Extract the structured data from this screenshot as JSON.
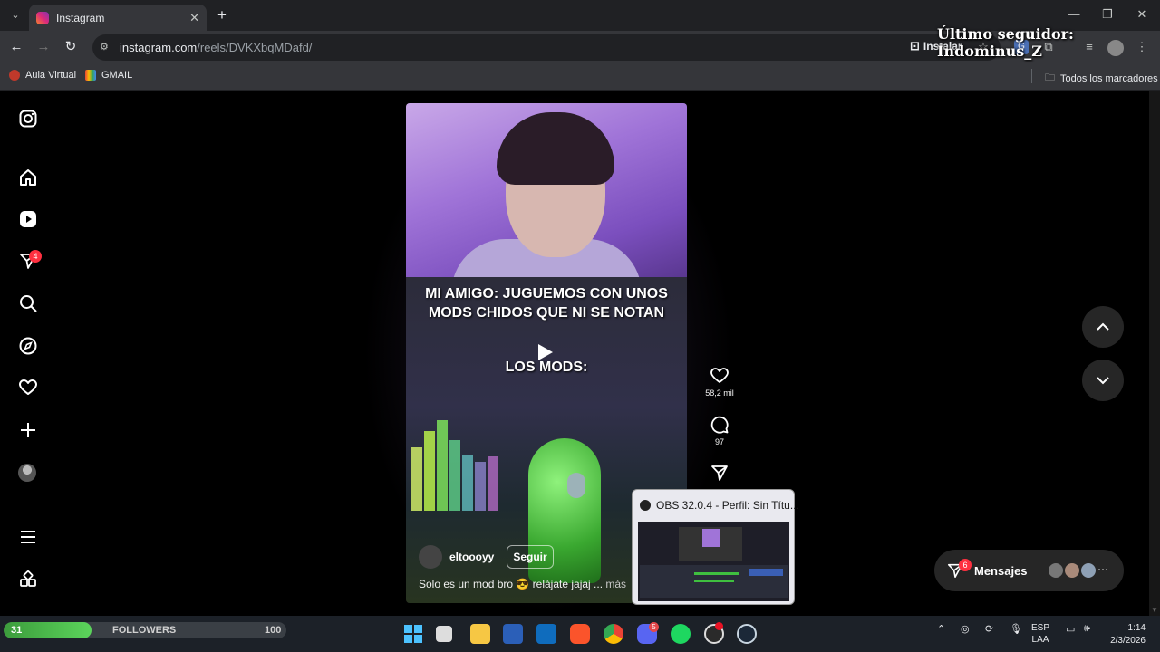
{
  "browser": {
    "tab_title": "Instagram",
    "url_host": "instagram.com",
    "url_path": "/reels/DVKXbqMDafd/",
    "install_label": "Instalar",
    "bookmarks": [
      "Aula Virtual",
      "GMAIL"
    ],
    "all_bookmarks": "Todos los marcadores"
  },
  "stream_overlay": {
    "last_follower": "Último seguidor: Indominus_Z"
  },
  "sidebar": {
    "notification_badge": "4"
  },
  "reel": {
    "caption_top": "MI AMIGO: JUGUEMOS CON UNOS MODS CHIDOS QUE NI SE NOTAN",
    "caption_bottom": "LOS MODS:",
    "username": "eltoooyy",
    "follow_label": "Seguir",
    "description": "Solo es un mod bro 😎 relájate jajaj ...",
    "more_label": "más",
    "likes": "58,2 mil",
    "comments": "97"
  },
  "messages": {
    "label": "Mensajes",
    "badge": "6"
  },
  "obs_preview": {
    "title": "OBS 32.0.4 - Perfil: Sin Títu..."
  },
  "taskbar": {
    "followers_label": "FOLLOWERS",
    "followers_current": "31",
    "followers_goal": "100",
    "followers_progress": 0.31,
    "discord_badge": "5",
    "lang_top": "ESP",
    "lang_bottom": "LAA",
    "time": "1:14",
    "date": "2/3/2026"
  },
  "colors": {
    "instagram_badge": "#ff3040",
    "followers_fill": "#5bd45b",
    "chrome_toolbar": "#35363a"
  }
}
